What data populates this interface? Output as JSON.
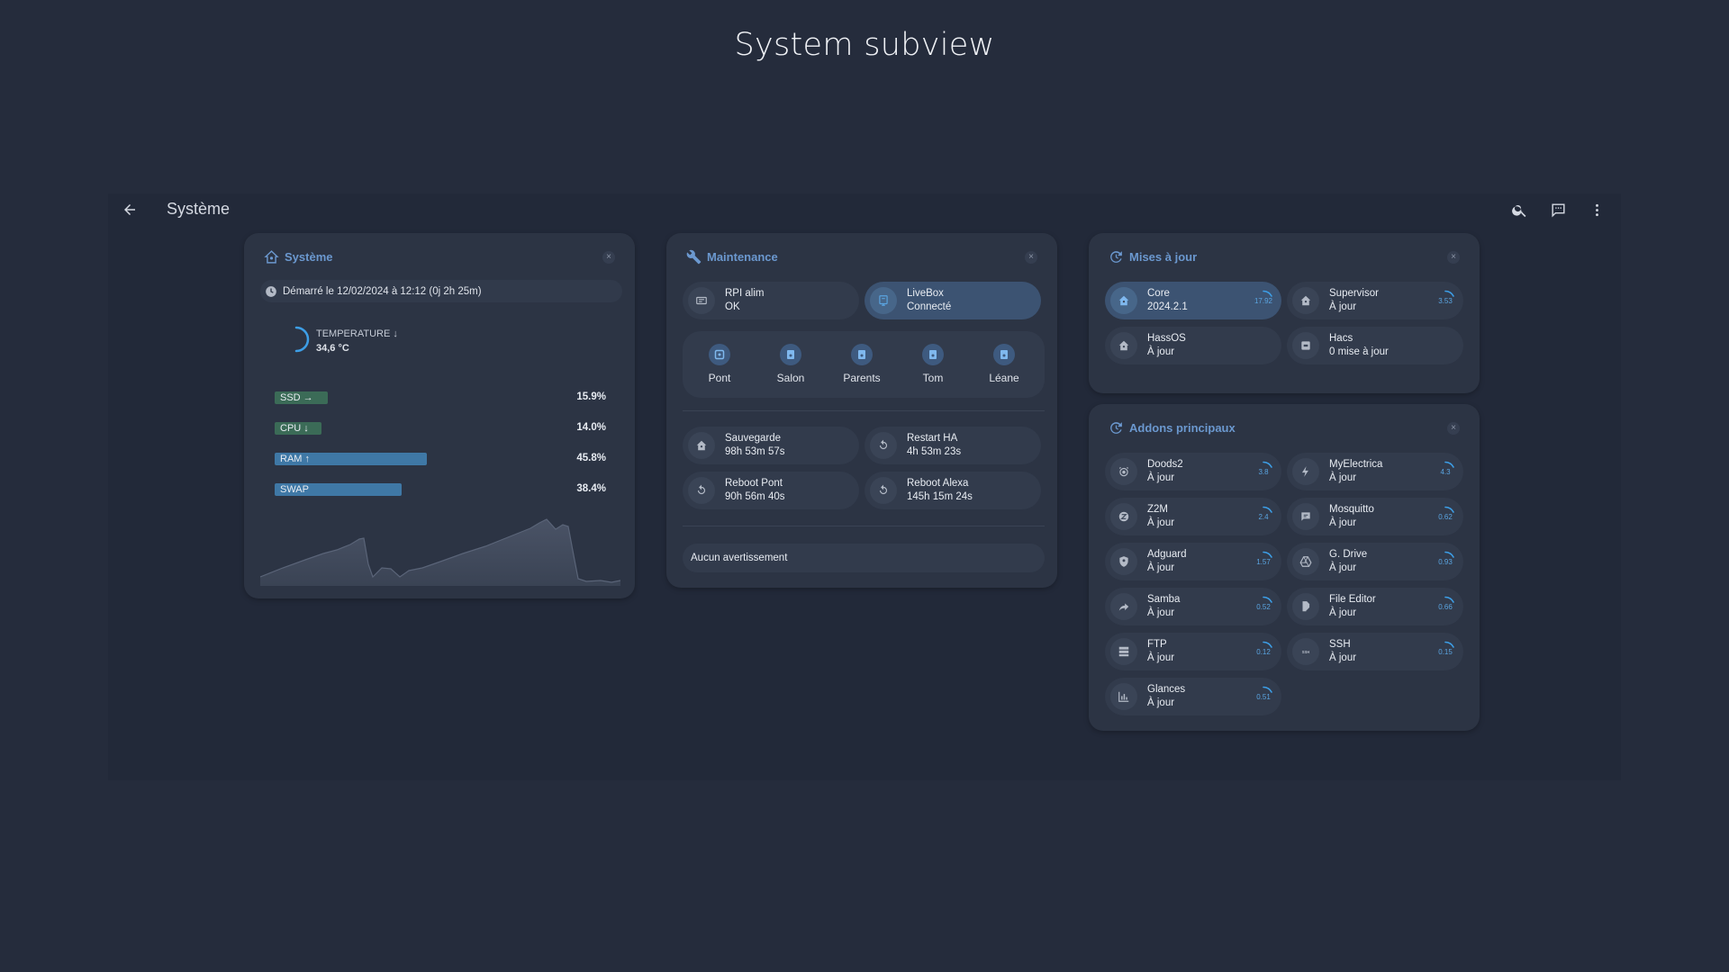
{
  "page": {
    "heading": "System subview"
  },
  "header": {
    "title": "Système"
  },
  "icons": {
    "back": "arrow-left-icon",
    "search": "search-icon",
    "comment": "comment-icon",
    "menu": "dots-vertical-icon"
  },
  "colors": {
    "accent": "#6b98cf",
    "ssd": "#3b6b57",
    "ram": "#3f78a6",
    "background": "#252c3c"
  },
  "system_card": {
    "title": "Système",
    "started": "Démarré le 12/02/2024 à 12:12 (0j 2h 25m)",
    "temperature": {
      "label": "TEMPERATURE ↓",
      "value": "34,6 °C"
    },
    "bars": [
      {
        "label": "SSD →",
        "value": "15.9%",
        "percent": 15.9,
        "color": "#3b6b57"
      },
      {
        "label": "CPU ↓",
        "value": "14.0%",
        "percent": 14.0,
        "color": "#3b6b57"
      },
      {
        "label": "RAM ↑",
        "value": "45.8%",
        "percent": 45.8,
        "color": "#3f78a6"
      },
      {
        "label": "SWAP",
        "value": "38.4%",
        "percent": 38.4,
        "color": "#3f78a6"
      }
    ]
  },
  "maintenance_card": {
    "title": "Maintenance",
    "status": [
      {
        "name": "RPI alim",
        "state": "OK"
      },
      {
        "name": "LiveBox",
        "state": "Connecté"
      }
    ],
    "rooms": [
      "Pont",
      "Salon",
      "Parents",
      "Tom",
      "Léane"
    ],
    "tasks": [
      {
        "name": "Sauvegarde",
        "time": "98h 53m 57s"
      },
      {
        "name": "Restart HA",
        "time": "4h 53m 23s"
      },
      {
        "name": "Reboot Pont",
        "time": "90h 56m 40s"
      },
      {
        "name": "Reboot Alexa",
        "time": "145h 15m 24s"
      }
    ],
    "alert": "Aucun avertissement"
  },
  "updates_card": {
    "title": "Mises à jour",
    "items": [
      {
        "name": "Core",
        "state": "2024.2.1",
        "value": "17.92"
      },
      {
        "name": "Supervisor",
        "state": "À jour",
        "value": "3.53"
      },
      {
        "name": "HassOS",
        "state": "À jour"
      },
      {
        "name": "Hacs",
        "state": "0 mise à jour"
      }
    ]
  },
  "addons_card": {
    "title": "Addons principaux",
    "items": [
      {
        "name": "Doods2",
        "state": "À jour",
        "value": "3.8"
      },
      {
        "name": "MyElectrica",
        "state": "À jour",
        "value": "4.3"
      },
      {
        "name": "Z2M",
        "state": "À jour",
        "value": "2.4"
      },
      {
        "name": "Mosquitto",
        "state": "À jour",
        "value": "0.62"
      },
      {
        "name": "Adguard",
        "state": "À jour",
        "value": "1.57"
      },
      {
        "name": "G. Drive",
        "state": "À jour",
        "value": "0.93"
      },
      {
        "name": "Samba",
        "state": "À jour",
        "value": "0.52"
      },
      {
        "name": "File Editor",
        "state": "À jour",
        "value": "0.66"
      },
      {
        "name": "FTP",
        "state": "À jour",
        "value": "0.12"
      },
      {
        "name": "SSH",
        "state": "À jour",
        "value": "0.15"
      },
      {
        "name": "Glances",
        "state": "À jour",
        "value": "0.51"
      }
    ]
  }
}
